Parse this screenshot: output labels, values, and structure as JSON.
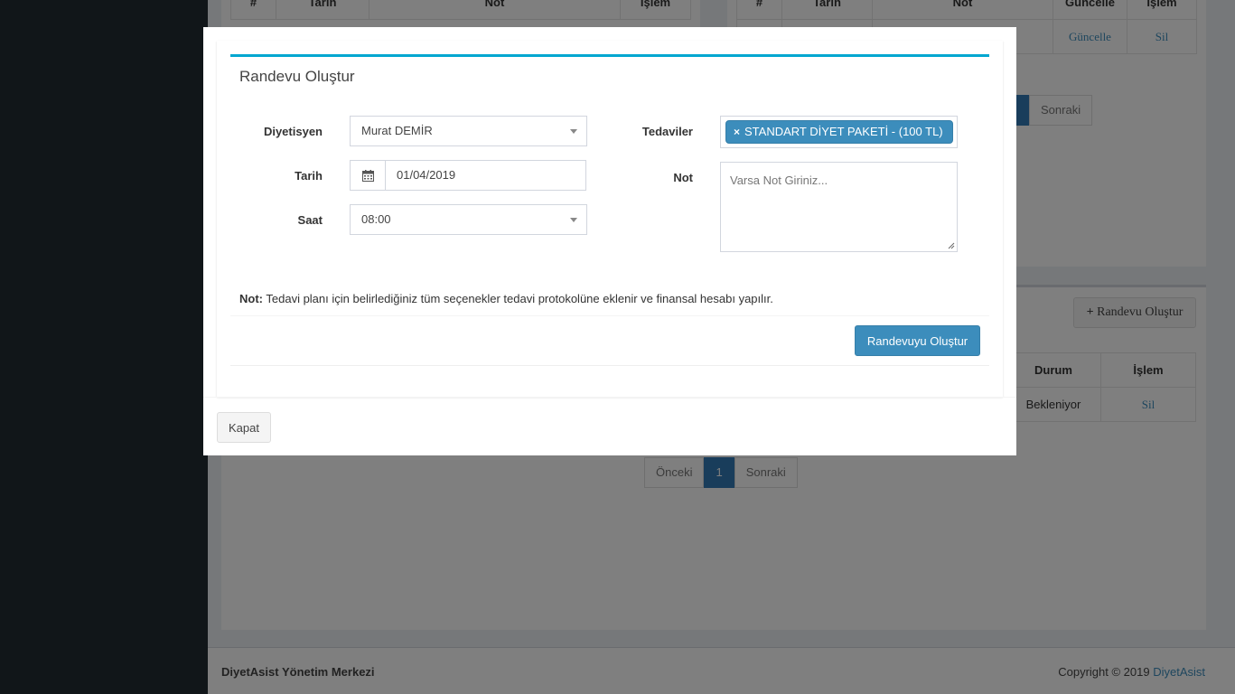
{
  "background": {
    "top_left_table": {
      "headers": [
        "#",
        "Tarih",
        "Not",
        "İşlem"
      ]
    },
    "top_right_table": {
      "headers": [
        "#",
        "Tarih",
        "Not",
        "Güncelle",
        "İşlem"
      ],
      "row": {
        "update": "Güncelle",
        "delete": "Sil"
      }
    },
    "top_pager_next": "Sonraki",
    "randevu_button": "Randevu Oluştur",
    "lower_table": {
      "headers": [
        "Durum",
        "İşlem"
      ],
      "row": {
        "status": "Bekleniyor",
        "delete": "Sil"
      }
    },
    "pager": {
      "prev": "Önceki",
      "page": "1",
      "next": "Sonraki"
    }
  },
  "footer": {
    "brand": "DiyetAsist Yönetim Merkezi",
    "copyright": "Copyright © 2019",
    "link": "DiyetAsist"
  },
  "modal": {
    "title": "Randevu Oluştur",
    "fields": {
      "diyetisyen_label": "Diyetisyen",
      "diyetisyen_value": "Murat DEMİR",
      "tarih_label": "Tarih",
      "tarih_value": "01/04/2019",
      "saat_label": "Saat",
      "saat_value": "08:00",
      "tedaviler_label": "Tedaviler",
      "tedaviler_tag": "STANDART DİYET PAKETİ - (100 TL)",
      "tag_remove": "×",
      "not_label": "Not",
      "not_placeholder": "Varsa Not Giriniz..."
    },
    "note_prefix": "Not:",
    "note_text": " Tedavi planı için belirlediğiniz tüm seçenekler tedavi protokolüne eklenir ve finansal hesabı yapılır.",
    "submit_label": "Randevuyu Oluştur",
    "close_label": "Kapat"
  },
  "colors": {
    "accent": "#3c8dbc",
    "box_top": "#00a7d0",
    "sidebar": "#222d32"
  }
}
